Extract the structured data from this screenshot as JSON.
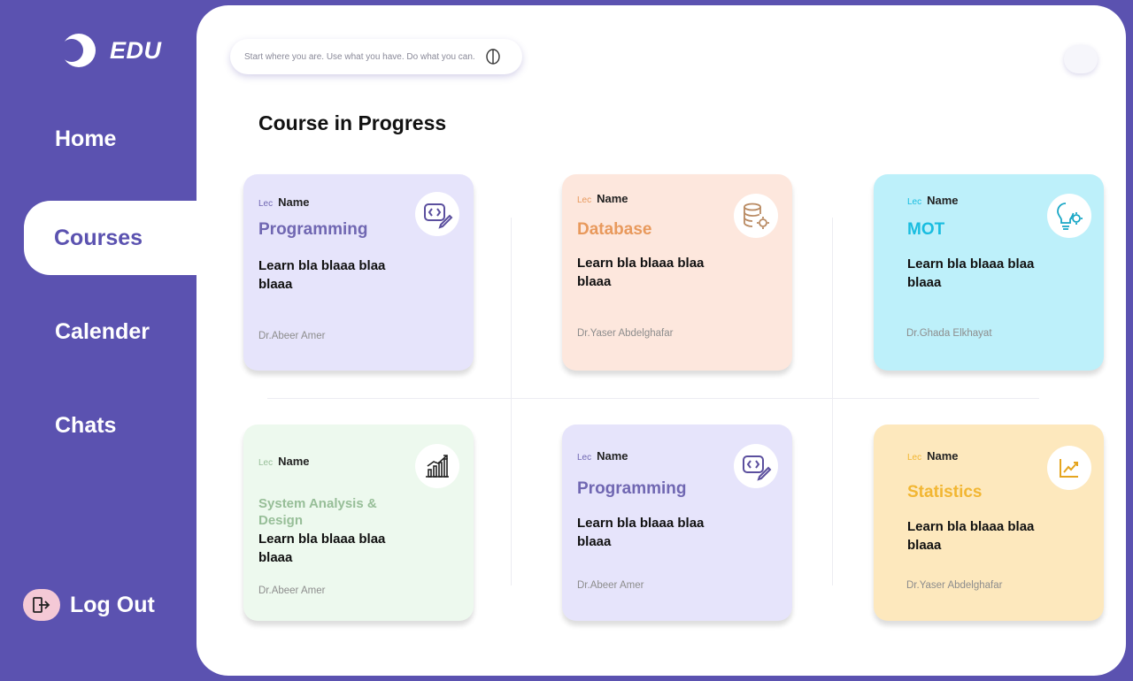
{
  "brand": {
    "name": "EDU"
  },
  "nav": {
    "home": "Home",
    "courses": "Courses",
    "calendar": "Calender",
    "chats": "Chats",
    "logout": "Log Out"
  },
  "search": {
    "placeholder": "Start where you are. Use what you have. Do what you can."
  },
  "section_title": "Course in Progress",
  "colors": {
    "sidebar": "#5b52b0",
    "panel": "#ffffff"
  },
  "cards": [
    {
      "lec_prefix": "Lec",
      "lec_name": "Name",
      "course": "Programming",
      "desc": "Learn bla blaaa blaa blaaa",
      "doctor": "Dr.Abeer Amer",
      "bg": "#e6e4fb",
      "accent": "#7067b2",
      "icon": "code-pen-icon"
    },
    {
      "lec_prefix": "Lec",
      "lec_name": "Name",
      "course": "Database",
      "desc": "Learn bla blaaa blaa blaaa",
      "doctor": "Dr.Yaser Abdelghafar",
      "bg": "#fde7dd",
      "accent": "#e8995c",
      "icon": "database-gear-icon"
    },
    {
      "lec_prefix": "Lec",
      "lec_name": "Name",
      "course": "MOT",
      "desc": "Learn bla blaaa blaa blaaa",
      "doctor": "Dr.Ghada Elkhayat",
      "bg": "#bdf0fa",
      "accent": "#19bde0",
      "icon": "bulb-gear-icon"
    },
    {
      "lec_prefix": "Lec",
      "lec_name": "Name",
      "course": "System Analysis & Design",
      "desc": "Learn bla blaaa blaa blaaa",
      "doctor": "Dr.Abeer Amer",
      "bg": "#edf9ee",
      "accent": "#97be98",
      "icon": "bar-chart-icon"
    },
    {
      "lec_prefix": "Lec",
      "lec_name": "Name",
      "course": "Programming",
      "desc": "Learn bla blaaa blaa blaaa",
      "doctor": "Dr.Abeer Amer",
      "bg": "#e6e4fb",
      "accent": "#7067b2",
      "icon": "code-pen-icon"
    },
    {
      "lec_prefix": "Lec",
      "lec_name": "Name",
      "course": "Statistics",
      "desc": "Learn bla blaaa blaa blaaa",
      "doctor": "Dr.Yaser Abdelghafar",
      "bg": "#fde8bd",
      "accent": "#f2b632",
      "icon": "trend-up-icon"
    }
  ]
}
